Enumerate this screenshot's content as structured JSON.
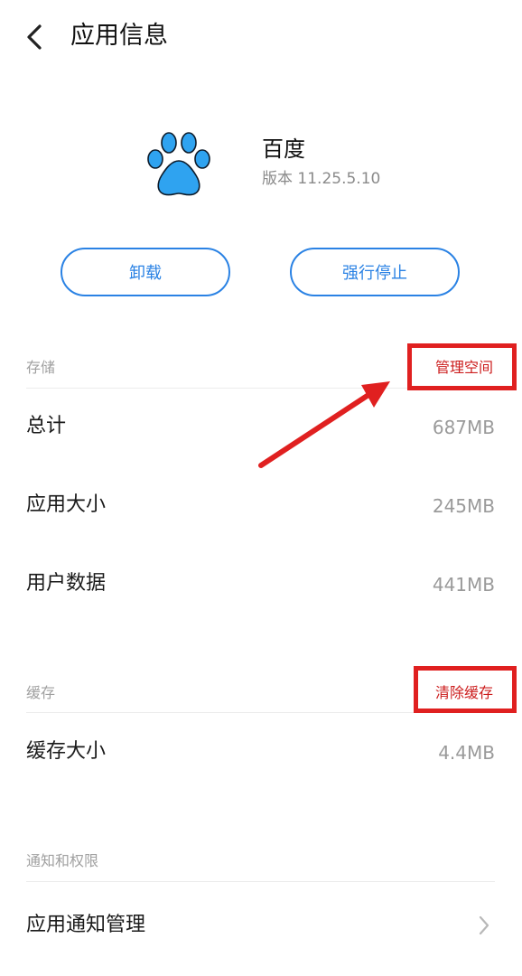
{
  "header": {
    "title": "应用信息",
    "back_icon": "chevron-left-icon"
  },
  "app": {
    "name": "百度",
    "version": "版本 11.25.5.10",
    "icon": "baidu-paw-icon",
    "icon_color": "#2fa3f0"
  },
  "actions": {
    "uninstall_label": "卸载",
    "force_stop_label": "强行停止",
    "accent": "#2a82e4"
  },
  "storage": {
    "label": "存储",
    "manage_label": "管理空间",
    "rows": [
      {
        "label": "总计",
        "value": "687MB"
      },
      {
        "label": "应用大小",
        "value": "245MB"
      },
      {
        "label": "用户数据",
        "value": "441MB"
      }
    ]
  },
  "cache": {
    "label": "缓存",
    "clear_label": "清除缓存",
    "rows": [
      {
        "label": "缓存大小",
        "value": "4.4MB"
      }
    ]
  },
  "notifications": {
    "label": "通知和权限",
    "rows": [
      {
        "label": "应用通知管理"
      }
    ]
  },
  "annotation_color": "#e02020"
}
